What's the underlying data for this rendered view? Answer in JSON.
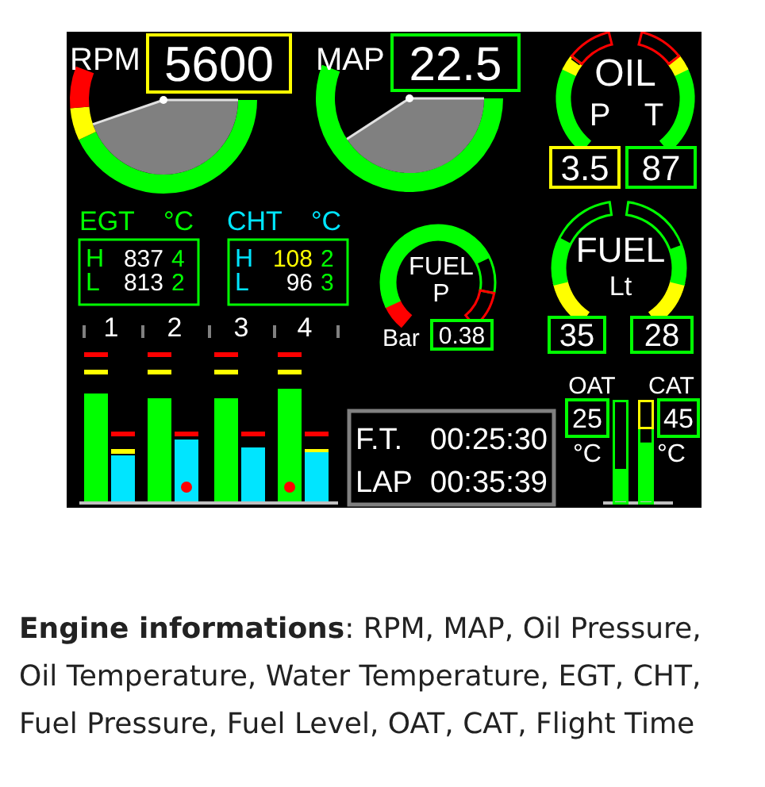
{
  "rpm": {
    "label": "RPM",
    "value": "5600",
    "caution": true
  },
  "map": {
    "label": "MAP",
    "value": "22.5",
    "caution": false
  },
  "oil": {
    "label": "OIL",
    "pressure": {
      "label": "P",
      "value": "3.5",
      "caution": true
    },
    "temperature": {
      "label": "T",
      "value": "87",
      "caution": false
    }
  },
  "egt": {
    "label": "EGT",
    "unit": "°C",
    "rows": [
      {
        "label": "H",
        "value": "837",
        "caution": false,
        "cylinder": "4"
      },
      {
        "label": "L",
        "value": "813",
        "caution": false,
        "cylinder": "2"
      }
    ]
  },
  "cht": {
    "label": "CHT",
    "unit": "°C",
    "rows": [
      {
        "label": "H",
        "value": "108",
        "caution": true,
        "cylinder": "2"
      },
      {
        "label": "L",
        "value": "96",
        "caution": false,
        "cylinder": "3"
      }
    ]
  },
  "cylinders": [
    {
      "number": "1",
      "egt_bar": {
        "peak": false
      },
      "cht_bar": {
        "peak": false
      }
    },
    {
      "number": "2",
      "egt_bar": {
        "peak": false
      },
      "cht_bar": {
        "peak": true
      }
    },
    {
      "number": "3",
      "egt_bar": {
        "peak": false
      },
      "cht_bar": {
        "peak": false
      }
    },
    {
      "number": "4",
      "egt_bar": {
        "peak": true
      },
      "cht_bar": {
        "peak": false
      }
    }
  ],
  "fuel_pressure": {
    "label": "FUEL",
    "sublabel": "P",
    "unit": "Bar",
    "value": "0.38",
    "caution": false
  },
  "fuel_level": {
    "label": "FUEL",
    "sublabel": "Lt",
    "tanks": [
      {
        "value": "35",
        "caution": false
      },
      {
        "value": "28",
        "caution": false
      }
    ]
  },
  "timers": [
    {
      "label": "F.T.",
      "value": "00:25:30"
    },
    {
      "label": "LAP",
      "value": "00:35:39"
    }
  ],
  "air_temperatures": [
    {
      "label": "OAT",
      "value": "25",
      "unit": "°C",
      "caution": false,
      "caution_band": false,
      "level": 0.32
    },
    {
      "label": "CAT",
      "value": "45",
      "unit": "°C",
      "caution": false,
      "caution_band": true,
      "level": 0.58
    }
  ],
  "caption": "**Engine informations**: RPM, MAP, Oil Pressure, Oil Temperature, Water Temperature, EGT, CHT, Fuel Pressure, Fuel Level, OAT, CAT, Flight Time"
}
